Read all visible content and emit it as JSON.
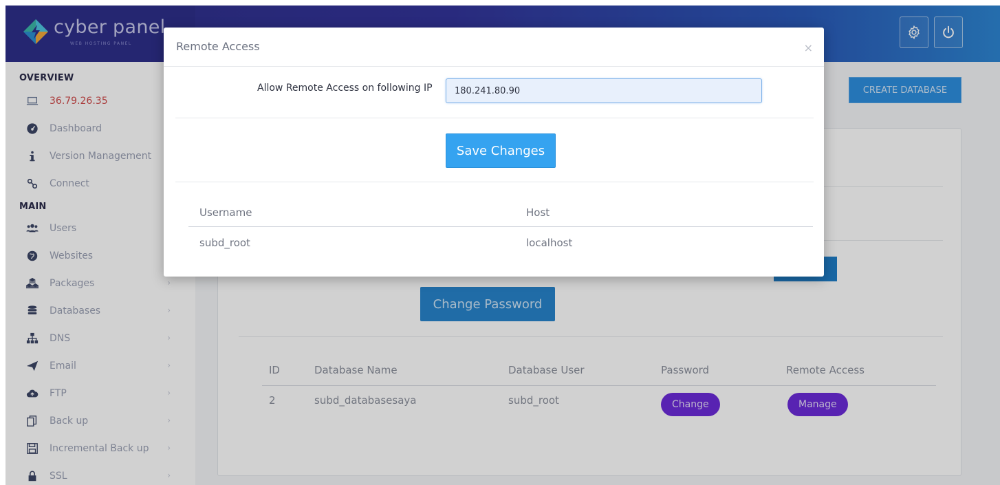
{
  "app": {
    "logo_text": "cyber panel",
    "logo_subtitle": "WEB HOSTING PANEL"
  },
  "header": {
    "settings_icon": "gear-icon",
    "power_icon": "power-icon"
  },
  "sidebar": {
    "overview_label": "OVERVIEW",
    "main_label": "MAIN",
    "overview_items": [
      {
        "label": "36.79.26.35",
        "icon": "laptop-icon"
      },
      {
        "label": "Dashboard",
        "icon": "dashboard-icon"
      },
      {
        "label": "Version Management",
        "icon": "info-icon"
      },
      {
        "label": "Connect",
        "icon": "link-icon"
      }
    ],
    "main_items": [
      {
        "label": "Users",
        "icon": "users-icon"
      },
      {
        "label": "Websites",
        "icon": "globe-icon"
      },
      {
        "label": "Packages",
        "icon": "cubes-icon"
      },
      {
        "label": "Databases",
        "icon": "database-icon"
      },
      {
        "label": "DNS",
        "icon": "sitemap-icon"
      },
      {
        "label": "Email",
        "icon": "send-icon"
      },
      {
        "label": "FTP",
        "icon": "cloud-upload-icon"
      },
      {
        "label": "Back up",
        "icon": "copy-icon"
      },
      {
        "label": "Incremental Back up",
        "icon": "save-icon"
      },
      {
        "label": "SSL",
        "icon": "lock-icon"
      }
    ]
  },
  "main": {
    "create_database_label": "CREATE DATABASE",
    "change_password_label": "Change Password",
    "db_table": {
      "headers": [
        "ID",
        "Database Name",
        "Database User",
        "Password",
        "Remote Access"
      ],
      "rows": [
        {
          "id": "2",
          "name": "subd_databasesaya",
          "user": "subd_root",
          "password_action": "Change",
          "remote_action": "Manage"
        }
      ]
    }
  },
  "modal": {
    "title": "Remote Access",
    "close_symbol": "×",
    "ip_label": "Allow Remote Access on following IP",
    "ip_value": "180.241.80.90",
    "save_label": "Save Changes",
    "table": {
      "headers": [
        "Username",
        "Host"
      ],
      "rows": [
        {
          "username": "subd_root",
          "host": "localhost"
        }
      ]
    }
  }
}
